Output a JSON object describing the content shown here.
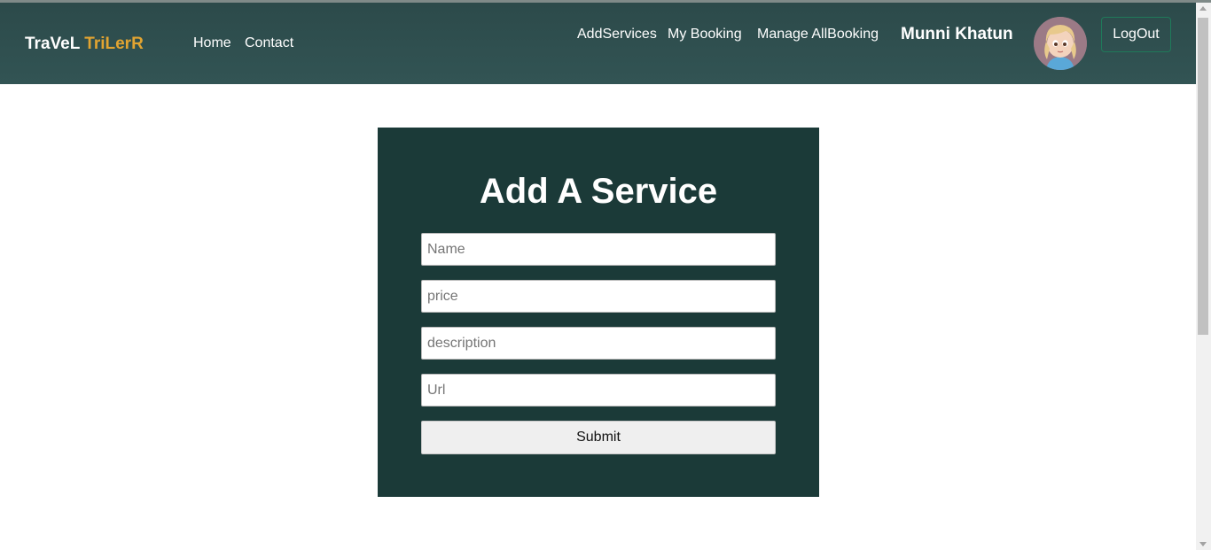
{
  "navbar": {
    "brand_part1": "TraVeL",
    "brand_part2": "TriLerR",
    "links": {
      "home": "Home",
      "contact": "Contact",
      "add_services": "AddServices",
      "my_booking": "My Booking",
      "manage_all_booking": "Manage AllBooking"
    },
    "user_name": "Munni Khatun",
    "logout_label": "LogOut",
    "colors": {
      "background": "#2f4f4f",
      "brand_accent": "#e2a431"
    }
  },
  "form": {
    "title": "Add A Service",
    "fields": {
      "name_placeholder": "Name",
      "price_placeholder": "price",
      "description_placeholder": "description",
      "url_placeholder": "Url"
    },
    "submit_label": "Submit",
    "colors": {
      "card_background": "#1b3a38"
    }
  }
}
